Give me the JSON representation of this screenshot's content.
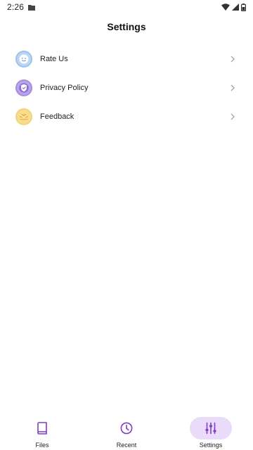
{
  "status_bar": {
    "time": "2:26",
    "notification_icon": "folder-icon",
    "system_icons": [
      "wifi-icon",
      "signal-icon",
      "battery-icon"
    ]
  },
  "header": {
    "title": "Settings"
  },
  "settings": {
    "items": [
      {
        "label": "Rate Us",
        "icon": "smiley-icon",
        "color": "#9ec3ea"
      },
      {
        "label": "Privacy Policy",
        "icon": "shield-check-icon",
        "color": "#a58ee0"
      },
      {
        "label": "Feedback",
        "icon": "envelope-icon",
        "color": "#f4d37a"
      }
    ]
  },
  "bottom_nav": {
    "items": [
      {
        "label": "Files",
        "icon": "book-icon",
        "active": false
      },
      {
        "label": "Recent",
        "icon": "clock-icon",
        "active": false
      },
      {
        "label": "Settings",
        "icon": "sliders-icon",
        "active": true
      }
    ],
    "accent_color": "#7e3fc2",
    "active_background": "#eadbfb"
  }
}
